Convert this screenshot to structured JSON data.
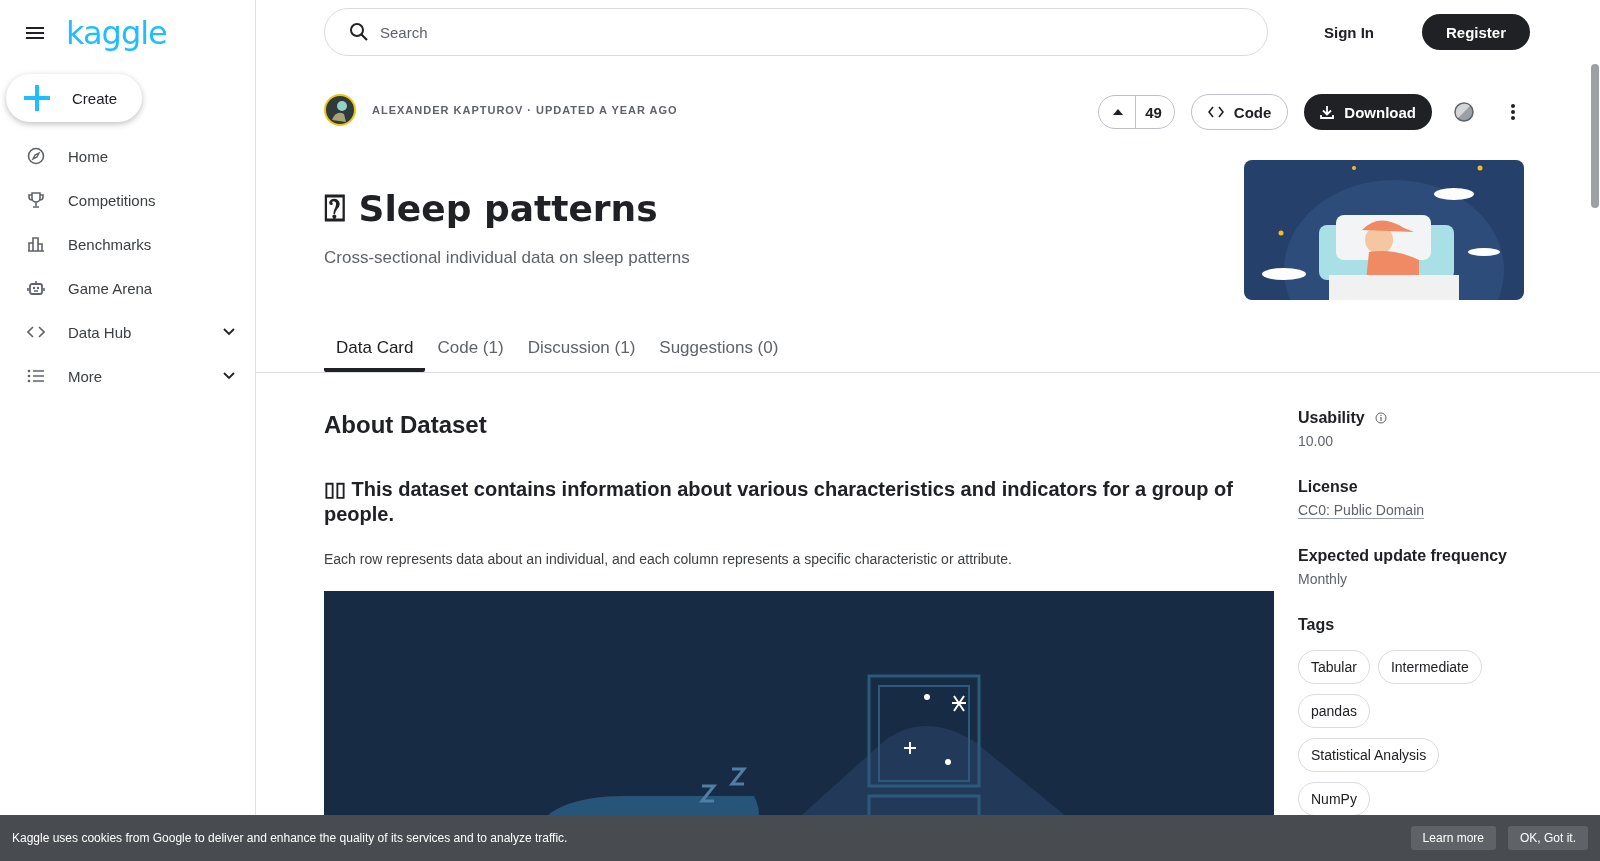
{
  "brand": {
    "logo": "kaggle"
  },
  "sidebar": {
    "create": "Create",
    "items": [
      {
        "label": "Home",
        "kind": "compass",
        "expandable": false
      },
      {
        "label": "Competitions",
        "kind": "trophy",
        "expandable": false
      },
      {
        "label": "Benchmarks",
        "kind": "bars",
        "expandable": false
      },
      {
        "label": "Game Arena",
        "kind": "robot",
        "expandable": false
      },
      {
        "label": "Data Hub",
        "kind": "code",
        "expandable": true
      },
      {
        "label": "More",
        "kind": "list",
        "expandable": true
      }
    ]
  },
  "header": {
    "search": {
      "placeholder": "Search"
    },
    "sign_in": "Sign In",
    "register": "Register"
  },
  "dataset": {
    "byline": "ALEXANDER KAPTUROV · UPDATED A YEAR AGO",
    "votes": "49",
    "code_button": "Code",
    "download_button": "Download",
    "title": "⍰ Sleep patterns",
    "subtitle": "Cross-sectional individual data on sleep patterns"
  },
  "tabs": [
    {
      "label": "Data Card",
      "selected": true
    },
    {
      "label": "Code (1)",
      "selected": false
    },
    {
      "label": "Discussion (1)",
      "selected": false
    },
    {
      "label": "Suggestions (0)",
      "selected": false
    }
  ],
  "about": {
    "heading": "About Dataset",
    "intro": "▯▯ This dataset contains information about various characteristics and indicators for a group of people.",
    "body": "Each row represents data about an individual, and each column represents a specific characteristic or attribute."
  },
  "meta": [
    {
      "label": "Usability",
      "value": "10.00",
      "kind": "info"
    },
    {
      "label": "License",
      "value": "CC0: Public Domain",
      "kind": "link"
    },
    {
      "label": "Expected update frequency",
      "value": "Monthly",
      "kind": "plain"
    }
  ],
  "tags": {
    "heading": "Tags",
    "items": [
      "Tabular",
      "Intermediate",
      "pandas",
      "Statistical Analysis",
      "NumPy"
    ]
  },
  "cookie_bar": {
    "message": "Kaggle uses cookies from Google to deliver and enhance the quality of its services and to analyze traffic.",
    "learn_more": "Learn more",
    "ok": "OK, Got it."
  }
}
